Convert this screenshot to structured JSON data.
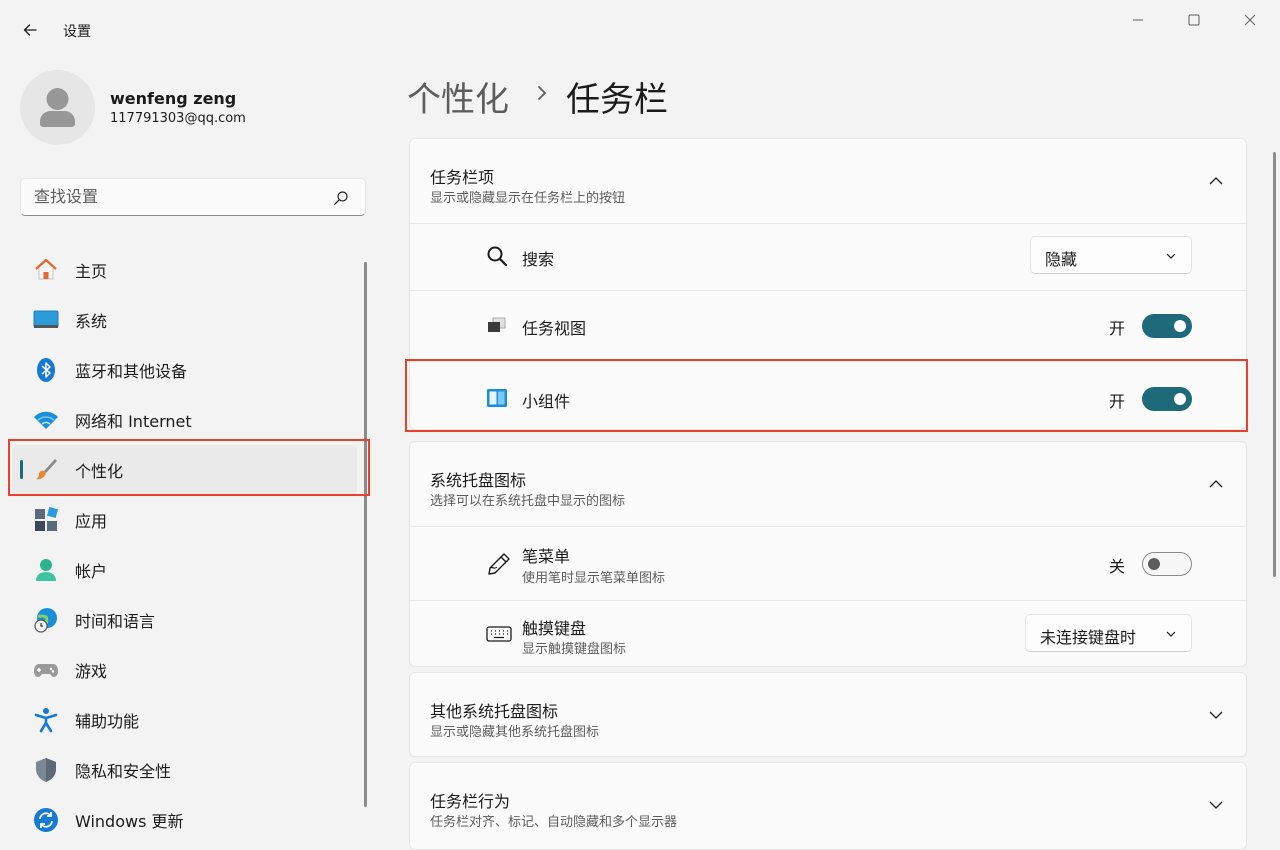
{
  "window": {
    "title": "设置",
    "controls": [
      "minimize-icon",
      "maximize-icon",
      "close-icon"
    ]
  },
  "user": {
    "name": "wenfeng zeng",
    "email": "117791303@qq.com"
  },
  "search": {
    "placeholder": "查找设置"
  },
  "sidebar": {
    "items": [
      {
        "label": "主页",
        "icon": "home-icon"
      },
      {
        "label": "系统",
        "icon": "system-icon"
      },
      {
        "label": "蓝牙和其他设备",
        "icon": "bluetooth-icon"
      },
      {
        "label": "网络和 Internet",
        "icon": "wifi-icon"
      },
      {
        "label": "个性化",
        "icon": "brush-icon",
        "selected": true
      },
      {
        "label": "应用",
        "icon": "apps-icon"
      },
      {
        "label": "帐户",
        "icon": "account-icon"
      },
      {
        "label": "时间和语言",
        "icon": "globe-clock-icon"
      },
      {
        "label": "游戏",
        "icon": "gamepad-icon"
      },
      {
        "label": "辅助功能",
        "icon": "accessibility-icon"
      },
      {
        "label": "隐私和安全性",
        "icon": "shield-icon"
      },
      {
        "label": "Windows 更新",
        "icon": "update-icon"
      }
    ]
  },
  "breadcrumb": {
    "parent": "个性化",
    "current": "任务栏"
  },
  "sections": {
    "taskbar_items": {
      "title": "任务栏项",
      "subtitle": "显示或隐藏显示在任务栏上的按钮",
      "expanded": true,
      "rows": {
        "search": {
          "label": "搜索",
          "icon": "search-icon",
          "value": "隐藏"
        },
        "task_view": {
          "label": "任务视图",
          "icon": "task-view-icon",
          "state": "开"
        },
        "widgets": {
          "label": "小组件",
          "icon": "widgets-icon",
          "state": "开"
        }
      }
    },
    "system_tray": {
      "title": "系统托盘图标",
      "subtitle": "选择可以在系统托盘中显示的图标",
      "expanded": true,
      "rows": {
        "pen_menu": {
          "label": "笔菜单",
          "sub": "使用笔时显示笔菜单图标",
          "icon": "pen-icon",
          "state": "关"
        },
        "touch_keyboard": {
          "label": "触摸键盘",
          "sub": "显示触摸键盘图标",
          "icon": "keyboard-icon",
          "value": "未连接键盘时"
        }
      }
    },
    "other_tray": {
      "title": "其他系统托盘图标",
      "subtitle": "显示或隐藏其他系统托盘图标",
      "expanded": false
    },
    "behaviors": {
      "title": "任务栏行为",
      "subtitle": "任务栏对齐、标记、自动隐藏和多个显示器",
      "expanded": false
    }
  },
  "colors": {
    "accent": "#1f6a7a",
    "highlight_box": "#e8412c"
  }
}
